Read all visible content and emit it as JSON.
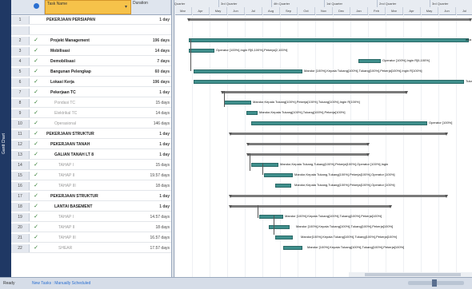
{
  "side_label": "Gantt Chart",
  "table": {
    "header": {
      "info_icon": "info-icon",
      "task_name": "Task Name",
      "duration": "Duration"
    },
    "rows": [
      {
        "num": "1",
        "check": "",
        "name": "PEKERJAAN PERSIAPAN",
        "dur": "1 day",
        "indent": 0,
        "style": "b"
      },
      {
        "num": "",
        "check": "",
        "name": "",
        "dur": "",
        "indent": 0,
        "style": "b"
      },
      {
        "num": "2",
        "check": "✓",
        "name": "Projekt Management",
        "dur": "196 days",
        "indent": 1,
        "style": "b"
      },
      {
        "num": "3",
        "check": "✓",
        "name": "Mobilisasi",
        "dur": "14 days",
        "indent": 1,
        "style": "b"
      },
      {
        "num": "4",
        "check": "✓",
        "name": "Demobilisasi",
        "dur": "7 days",
        "indent": 1,
        "style": "b"
      },
      {
        "num": "5",
        "check": "✓",
        "name": "Bangunan Pelengkap",
        "dur": "60 days",
        "indent": 1,
        "style": "b"
      },
      {
        "num": "6",
        "check": "✓",
        "name": "Lokasi Kerja",
        "dur": "196 days",
        "indent": 1,
        "style": "b"
      },
      {
        "num": "7",
        "check": "✓",
        "name": "Pekerjaan TC",
        "dur": "1 day",
        "indent": 1,
        "style": "b"
      },
      {
        "num": "8",
        "check": "✓",
        "name": "Pondasi TC",
        "dur": "15 days",
        "indent": 2,
        "style": "g"
      },
      {
        "num": "9",
        "check": "✓",
        "name": "Elektrikal TC",
        "dur": "14 days",
        "indent": 2,
        "style": "g"
      },
      {
        "num": "10",
        "check": "✓",
        "name": "Operasional",
        "dur": "146 days",
        "indent": 2,
        "style": "g"
      },
      {
        "num": "11",
        "check": "✓",
        "name": "PEKERJAAN STRUKTUR",
        "dur": "1 day",
        "indent": 0,
        "style": "b"
      },
      {
        "num": "12",
        "check": "✓",
        "name": "PEKERJAAN TANAH",
        "dur": "1 day",
        "indent": 1,
        "style": "b"
      },
      {
        "num": "13",
        "check": "✓",
        "name": "GALIAN TANAH LT 8",
        "dur": "1 day",
        "indent": 2,
        "style": "b"
      },
      {
        "num": "14",
        "check": "✓",
        "name": "TAHAP I",
        "dur": "15 days",
        "indent": 3,
        "style": "g"
      },
      {
        "num": "15",
        "check": "✓",
        "name": "TAHAP II",
        "dur": "19.57 days",
        "indent": 3,
        "style": "g"
      },
      {
        "num": "16",
        "check": "✓",
        "name": "TAHAP III",
        "dur": "18 days",
        "indent": 3,
        "style": "g"
      },
      {
        "num": "17",
        "check": "✓",
        "name": "PEKERJAAN STRUKTUR",
        "dur": "1 day",
        "indent": 1,
        "style": "b"
      },
      {
        "num": "18",
        "check": "✓",
        "name": "LANTAI BASEMENT",
        "dur": "1 day",
        "indent": 2,
        "style": "b"
      },
      {
        "num": "19",
        "check": "✓",
        "name": "TAHAP I",
        "dur": "14.57 days",
        "indent": 3,
        "style": "g"
      },
      {
        "num": "20",
        "check": "✓",
        "name": "TAHAP II",
        "dur": "18 days",
        "indent": 3,
        "style": "g"
      },
      {
        "num": "21",
        "check": "✓",
        "name": "TAHAP III",
        "dur": "16.57 days",
        "indent": 3,
        "style": "g"
      },
      {
        "num": "22",
        "check": "✓",
        "name": "SHEAR",
        "dur": "17.57 days",
        "indent": 3,
        "style": "g"
      }
    ]
  },
  "gantt": {
    "quarters": [
      "2nd Quarter",
      "3rd Quarter",
      "4th Quarter",
      "1st Quarter",
      "2nd Quarter",
      "3rd Quarter"
    ],
    "months": [
      "Mar",
      "Apr",
      "May",
      "Jun",
      "Jul",
      "Aug",
      "Sep",
      "Oct",
      "Nov",
      "Dec",
      "Jan",
      "Feb",
      "Mar",
      "Apr",
      "May",
      "Jun",
      "Jul"
    ],
    "labels": {
      "r2": "",
      "r3": "Operator [100%],Ingin R[6,100%],Pekerja[2,100%]",
      "r4": "Operator [100%],Ingin R[6,100%]",
      "r5": "Mandor [100%],Kepala Tukang[100%],Tukang[100%],Pekerja[100%],Ingin R[100%]",
      "r6": "Tukang",
      "r8": "Mandor,Kepala Tukang[100%],Pekerja[100%],Tukang[100%],Ingin R[100%]",
      "r9": "Mandor,Kepala Tukang[100%],Tukang[100%],Pekerja[100%]",
      "r10": "Operator [100%]",
      "r14": "Mandor,Kepala Tukang,Tukang[100%],Pekerja[100%],Operator [100%],Ingin",
      "r15": "Mandor,Kepala Tukang,Tukang[100%],Pekerja[100%],Operator [100%]",
      "r16": "Mandor,Kepala Tukang,Tukang[100%],Pekerja[100%],Operator [100%]",
      "r19": "Mandor [100%],Kepala Tukang[100%],Tukang[100%],Pekerja[100%]",
      "r20": "Mandor [100%],Kepala Tukang[100%],Tukang[100%],Pekerja[100%]",
      "r21": "Mandor[100%],Kepala Tukang[100%],Tukang[100%],Pekerja[100%]",
      "r22": "Mandor [100%],Kepala Tukang[100%],Tukang[100%],Pekerja[100%]"
    },
    "end_label_r2": "wka"
  },
  "status": {
    "mode": "Ready",
    "new_tasks": "New Tasks : Manually Scheduled"
  },
  "colors": {
    "bar": "#3f8f8c",
    "summary": "#7a7a7a",
    "header": "#dfe5ee",
    "sidebar": "#1f3864"
  }
}
